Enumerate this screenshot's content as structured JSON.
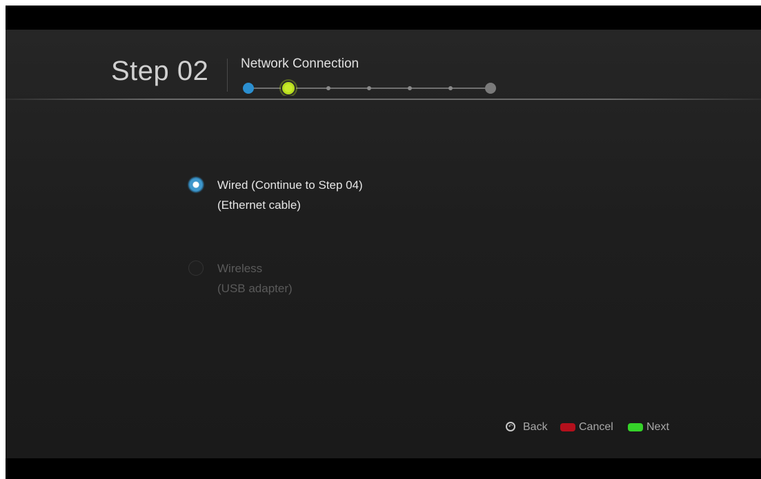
{
  "header": {
    "step_label": "Step 02",
    "title": "Network Connection",
    "progress": {
      "total_steps": 7,
      "current_step": 2
    }
  },
  "options": [
    {
      "label": "Wired (Continue to Step 04)",
      "sublabel": "(Ethernet cable)",
      "selected": true,
      "enabled": true
    },
    {
      "label": "Wireless",
      "sublabel": "(USB adapter)",
      "selected": false,
      "enabled": false
    }
  ],
  "footer": {
    "back_label": "Back",
    "cancel_label": "Cancel",
    "next_label": "Next"
  },
  "colors": {
    "completed_step": "#2b8fd0",
    "current_step": "#b7dd1f",
    "cancel_key": "#b3101c",
    "next_key": "#35d229",
    "radio_selected": "#3f97cc"
  },
  "icons": {
    "back": "back-button-icon",
    "radio_on": "radio-selected-icon",
    "radio_off": "radio-unselected-icon"
  }
}
